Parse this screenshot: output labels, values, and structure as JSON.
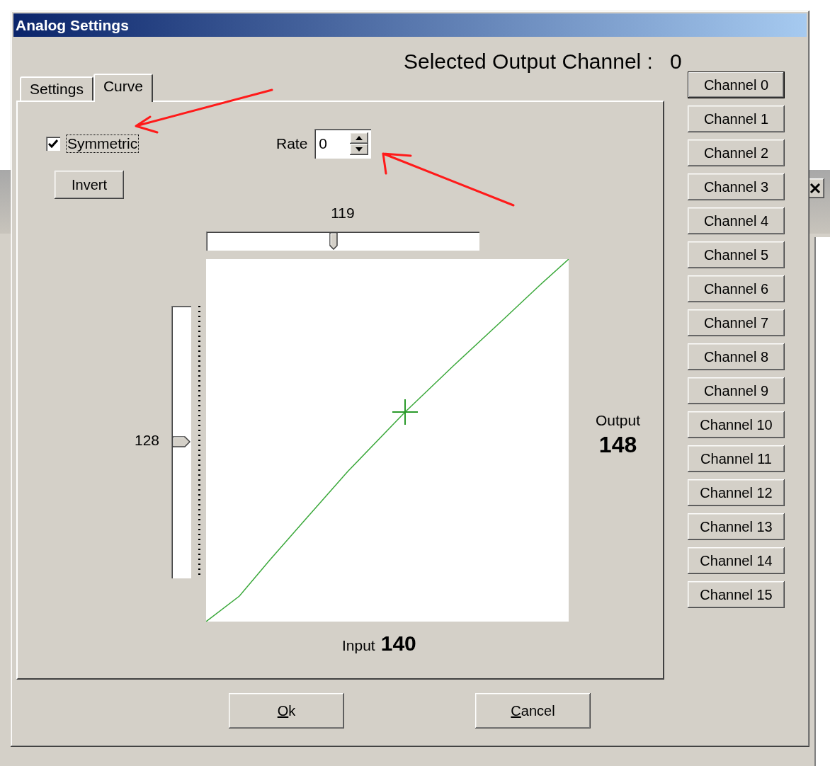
{
  "window": {
    "title": "Analog Settings"
  },
  "heading": {
    "label": "Selected Output Channel :",
    "value": "0"
  },
  "tabs": [
    {
      "label": "Settings",
      "selected": false
    },
    {
      "label": "Curve",
      "selected": true
    }
  ],
  "curve": {
    "symmetric": {
      "label": "Symmetric",
      "checked": true
    },
    "invert_button": "Invert",
    "rate": {
      "label": "Rate",
      "value": "0"
    },
    "input_slider": {
      "reading": "119",
      "level": 0.467
    },
    "output_slider": {
      "reading": "128",
      "level": 0.5
    },
    "output": {
      "label": "Output",
      "value": "148"
    },
    "input": {
      "label": "Input",
      "value": "140"
    }
  },
  "channels": [
    {
      "label": "Channel 0",
      "selected": true
    },
    {
      "label": "Channel 1",
      "selected": false
    },
    {
      "label": "Channel 2",
      "selected": false
    },
    {
      "label": "Channel 3",
      "selected": false
    },
    {
      "label": "Channel 4",
      "selected": false
    },
    {
      "label": "Channel 5",
      "selected": false
    },
    {
      "label": "Channel 6",
      "selected": false
    },
    {
      "label": "Channel 7",
      "selected": false
    },
    {
      "label": "Channel 8",
      "selected": false
    },
    {
      "label": "Channel 9",
      "selected": false
    },
    {
      "label": "Channel 10",
      "selected": false
    },
    {
      "label": "Channel 11",
      "selected": false
    },
    {
      "label": "Channel 12",
      "selected": false
    },
    {
      "label": "Channel 13",
      "selected": false
    },
    {
      "label": "Channel 14",
      "selected": false
    },
    {
      "label": "Channel 15",
      "selected": false
    }
  ],
  "buttons": [
    {
      "mnemonic": "O",
      "rest": "k"
    },
    {
      "mnemonic": "C",
      "rest": "ancel"
    }
  ]
}
